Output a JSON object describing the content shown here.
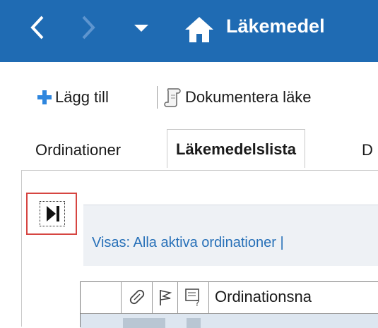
{
  "header": {
    "title": "Läkemedel",
    "color": "#1f6bb3",
    "icons": [
      "back-arrow-icon",
      "forward-arrow-icon",
      "dropdown-arrow-icon",
      "home-icon"
    ]
  },
  "toolbar": {
    "add_label": "Lägg till",
    "document_label": "Dokumentera läke"
  },
  "tabs": [
    {
      "label": "Ordinationer"
    },
    {
      "label": "Läkemedelslista",
      "selected": true
    },
    {
      "label": "D"
    }
  ],
  "filter": {
    "text": "Visas: Alla aktiva ordinationer  |"
  },
  "grid": {
    "columns": [
      {
        "icon": "pills-icon"
      },
      {
        "icon": "flag-icon"
      },
      {
        "icon": "document-question-icon"
      },
      {
        "label": "Ordinationsna"
      }
    ]
  },
  "highlight_color": "#d64541"
}
